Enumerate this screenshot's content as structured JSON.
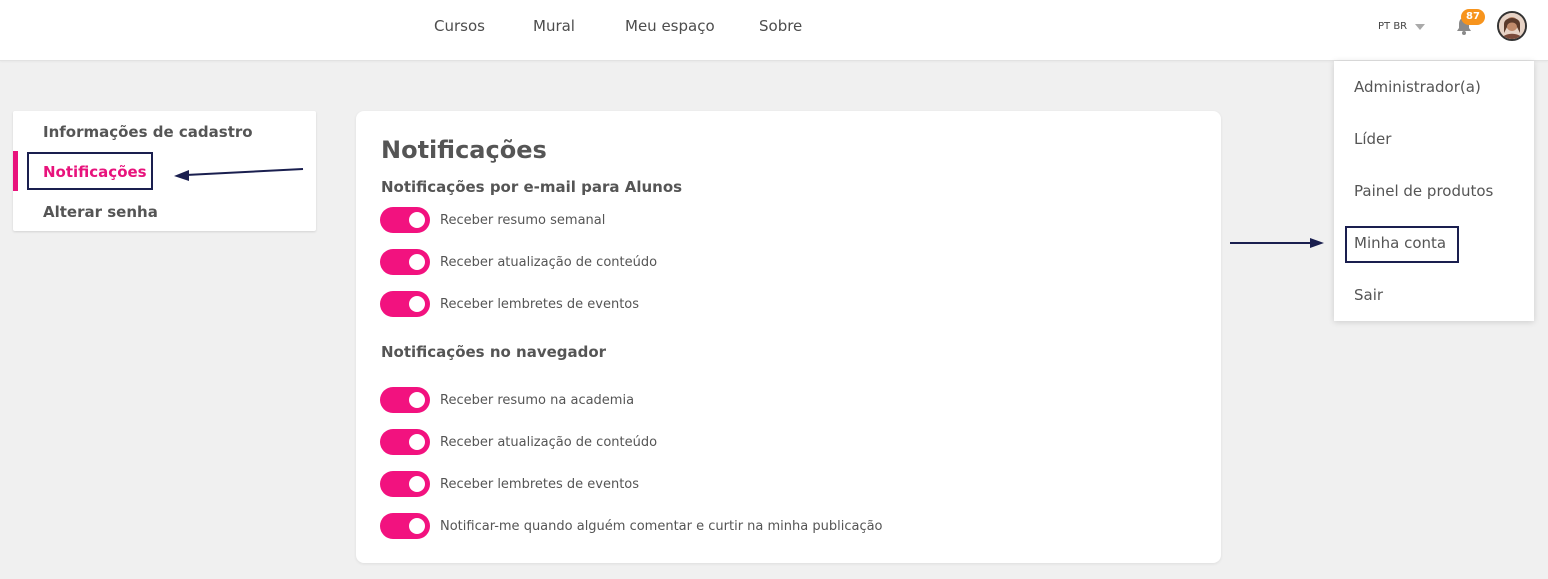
{
  "nav": {
    "items": [
      "Cursos",
      "Mural",
      "Meu espaço",
      "Sobre"
    ]
  },
  "header": {
    "language": "PT BR",
    "notification_count": "87",
    "icons": {
      "bell": "bell-icon",
      "avatar": "user-avatar",
      "lang_caret": "caret-down-icon"
    }
  },
  "dropdown": {
    "items": [
      "Administrador(a)",
      "Líder",
      "Painel de produtos",
      "Minha conta",
      "Sair"
    ],
    "highlighted": "Minha conta"
  },
  "sidebar": {
    "items": [
      "Informações de cadastro",
      "Notificações",
      "Alterar senha"
    ],
    "active": "Notificações"
  },
  "card": {
    "title": "Notificações",
    "email_section": {
      "heading": "Notificações por e-mail para Alunos",
      "toggles": [
        {
          "label": "Receber resumo semanal",
          "on": true
        },
        {
          "label": "Receber atualização de conteúdo",
          "on": true
        },
        {
          "label": "Receber lembretes de eventos",
          "on": true
        }
      ]
    },
    "browser_section": {
      "heading": "Notificações no navegador",
      "toggles": [
        {
          "label": "Receber resumo na academia",
          "on": true
        },
        {
          "label": "Receber atualização de conteúdo",
          "on": true
        },
        {
          "label": "Receber lembretes de eventos",
          "on": true
        },
        {
          "label": "Notificar-me quando alguém comentar e curtir na minha publicação",
          "on": true
        }
      ]
    }
  },
  "colors": {
    "accent": "#e8137c",
    "toggle_on": "#f2127f",
    "badge": "#f7941d",
    "annotation": "#1a1f4f",
    "background": "#f0f0f0"
  }
}
